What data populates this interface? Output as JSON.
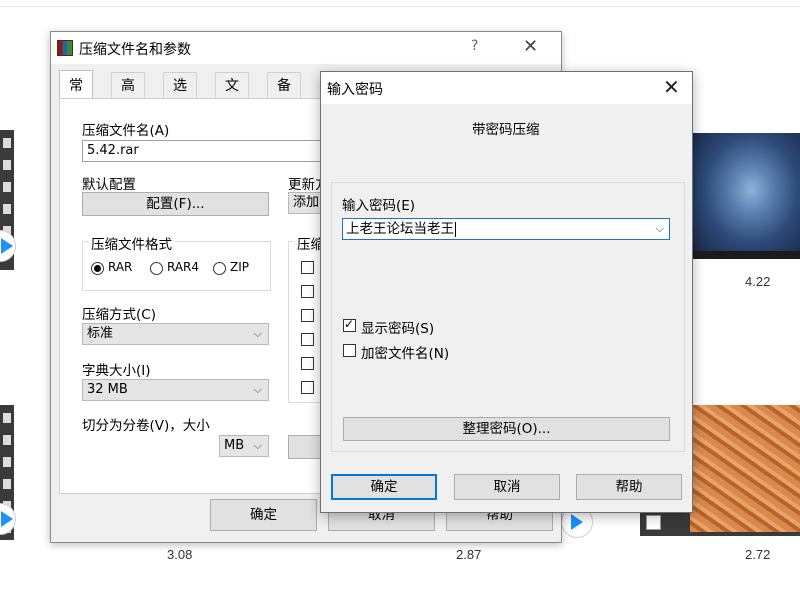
{
  "background": {
    "thumb_labels": [
      "4.22",
      "3.08",
      "2.87",
      "2.72"
    ]
  },
  "main_dialog": {
    "title": "压缩文件名和参数",
    "help_glyph": "?",
    "close_glyph": "✕",
    "tabs": [
      "常规",
      "高级",
      "选项",
      "文件",
      "备份"
    ],
    "active_tab": "常规",
    "archive_name_label": "压缩文件名(A)",
    "archive_name_value": "5.42.rar",
    "default_profile_label": "默认配置",
    "profile_button": "配置(F)...",
    "update_mode_label": "更新方",
    "update_mode_value": "添加",
    "format_group_label": "压缩文件格式",
    "formats": [
      "RAR",
      "RAR4",
      "ZIP"
    ],
    "selected_format": "RAR",
    "options_group_label": "压缩",
    "compression_method_label": "压缩方式(C)",
    "compression_method_value": "标准",
    "dictionary_label": "字典大小(I)",
    "dictionary_value": "32 MB",
    "split_label": "切分为分卷(V)，大小",
    "split_unit": "MB",
    "ok_button": "确定",
    "cancel_button": "取消",
    "help_button": "帮助"
  },
  "password_dialog": {
    "title": "输入密码",
    "close_glyph": "✕",
    "heading": "带密码压缩",
    "password_label": "输入密码(E)",
    "password_value": "上老王论坛当老王",
    "show_password_label": "显示密码(S)",
    "show_password_checked": true,
    "encrypt_names_label": "加密文件名(N)",
    "encrypt_names_checked": false,
    "organize_button": "整理密码(O)...",
    "ok_button": "确定",
    "cancel_button": "取消",
    "help_button": "帮助"
  },
  "colors": {
    "accent": "#0078d7",
    "dialog_bg": "#f0f0f0",
    "button_bg": "#e1e1e1"
  }
}
